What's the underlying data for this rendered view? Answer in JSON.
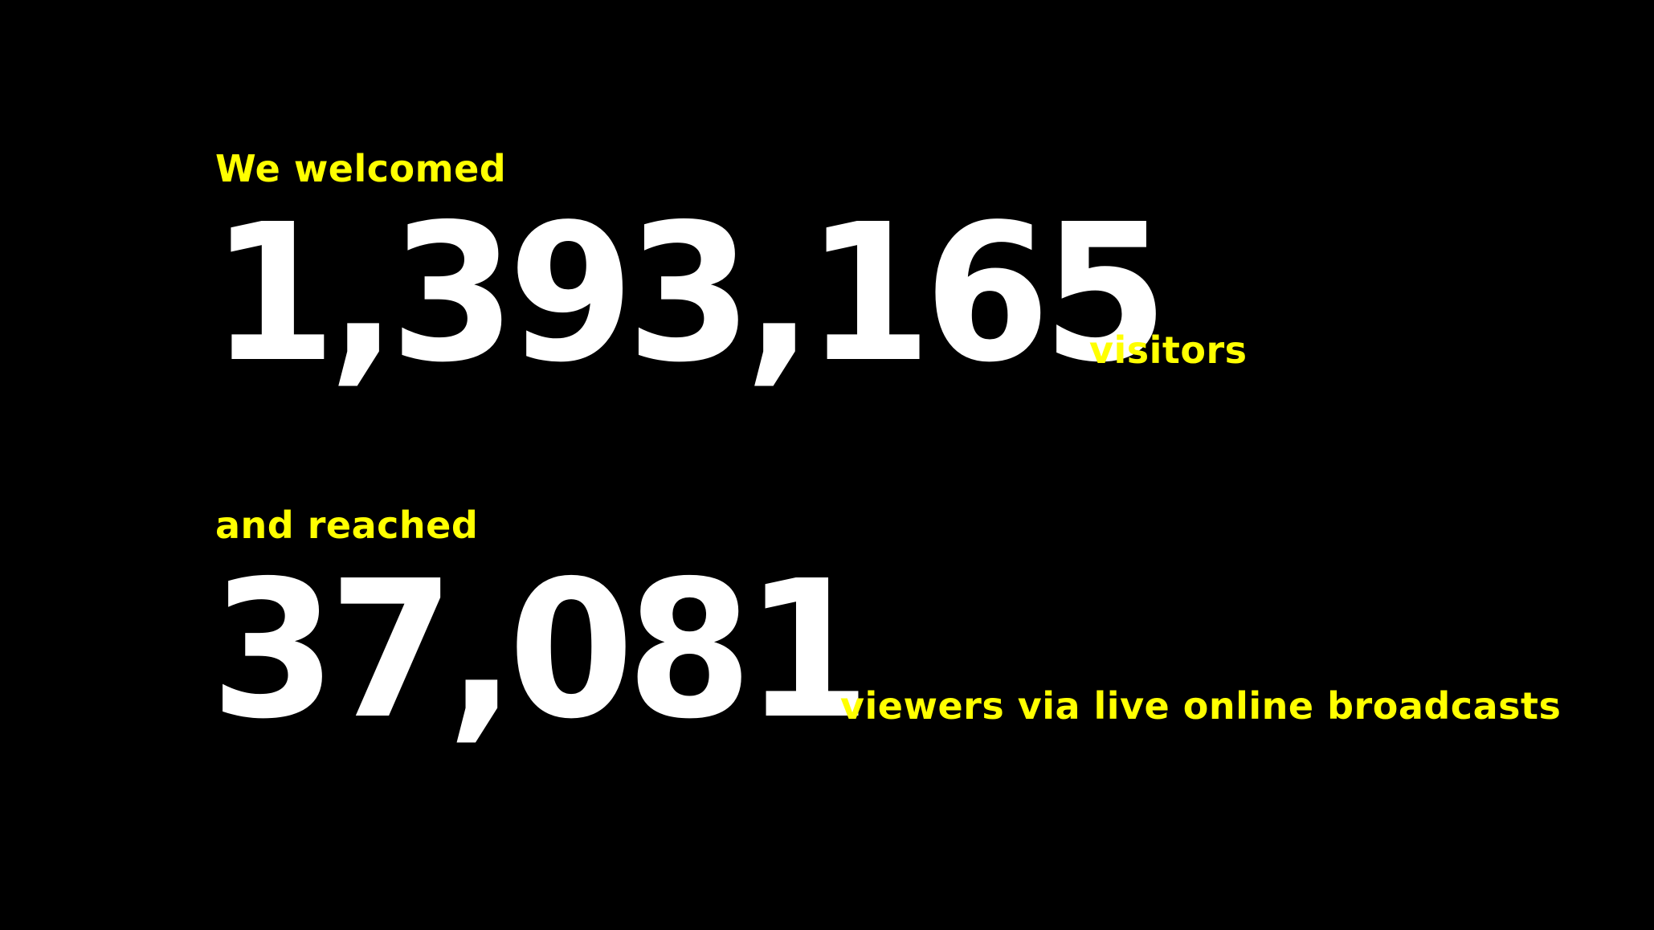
{
  "colors": {
    "background": "#000000",
    "number": "#ffffff",
    "accent": "#ffff00"
  },
  "visitors": {
    "intro": "We welcomed",
    "value": "1,393,165",
    "caption": "visitors"
  },
  "broadcasts": {
    "intro": "and reached",
    "value": "37,081",
    "caption": "viewers via live online broadcasts"
  }
}
